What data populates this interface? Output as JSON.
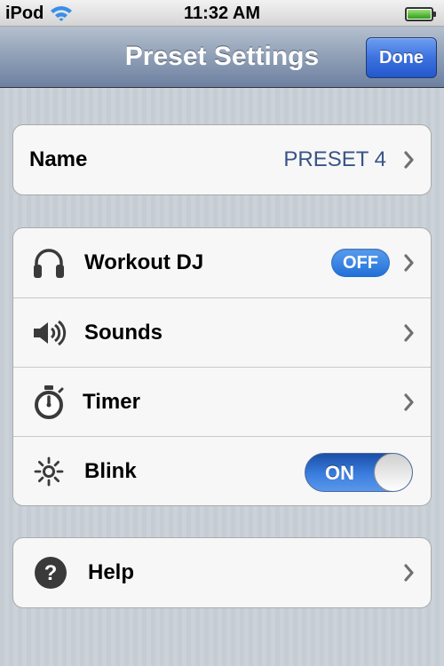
{
  "status_bar": {
    "carrier": "iPod",
    "time": "11:32 AM",
    "wifi_icon": "wifi-icon",
    "battery_icon": "battery-icon"
  },
  "nav_bar": {
    "title": "Preset Settings",
    "done_label": "Done"
  },
  "name_group": {
    "label": "Name",
    "value": "PRESET 4"
  },
  "settings_group": {
    "items": [
      {
        "icon": "headphones-icon",
        "label": "Workout DJ",
        "badge": "OFF"
      },
      {
        "icon": "speaker-icon",
        "label": "Sounds"
      },
      {
        "icon": "stopwatch-icon",
        "label": "Timer"
      },
      {
        "icon": "light-icon",
        "label": "Blink",
        "toggle_label": "ON",
        "toggle_on": true
      }
    ]
  },
  "help_group": {
    "icon": "help-icon",
    "label": "Help"
  },
  "colors": {
    "nav_bar": "#8f9fb6",
    "done_button": "#3d72de",
    "value_text": "#385487",
    "badge_blue": "#1f6fd6",
    "background": "#c5ccd4"
  }
}
